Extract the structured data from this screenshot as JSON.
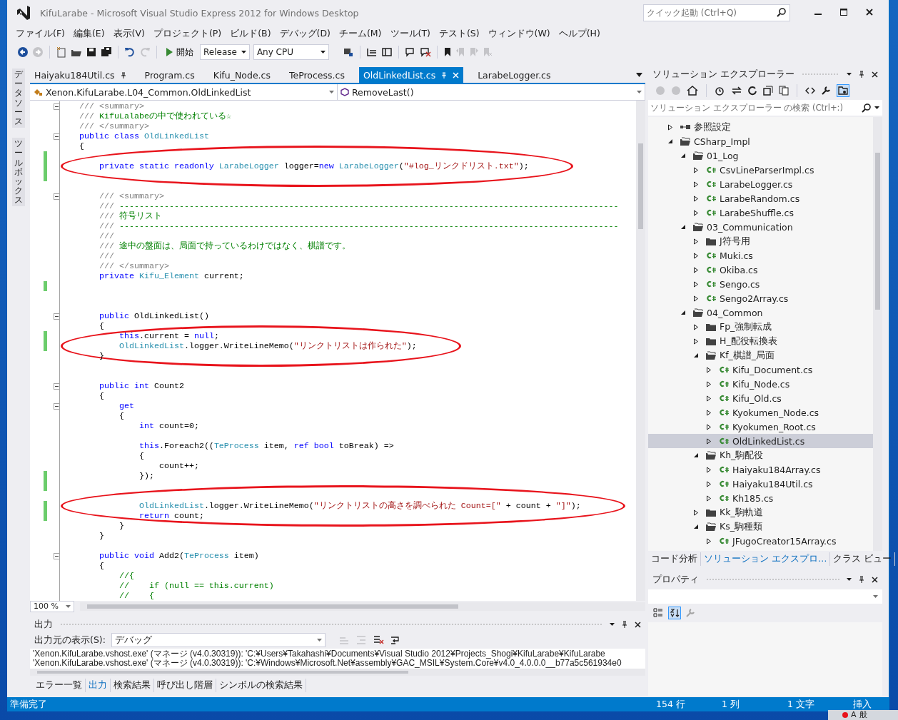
{
  "window": {
    "title": "KifuLarabe - Microsoft Visual Studio Express 2012 for Windows Desktop"
  },
  "quick_launch": {
    "placeholder": "クイック起動 (Ctrl+Q)"
  },
  "menu": [
    "ファイル(F)",
    "編集(E)",
    "表示(V)",
    "プロジェクト(P)",
    "ビルド(B)",
    "デバッグ(D)",
    "チーム(M)",
    "ツール(T)",
    "テスト(S)",
    "ウィンドウ(W)",
    "ヘルプ(H)"
  ],
  "toolbar": {
    "start_button": "開始",
    "configuration": "Release",
    "platform": "Any CPU"
  },
  "side_tabs": [
    "データソース",
    "ツールボックス"
  ],
  "editor": {
    "tabs": [
      {
        "label": "Haiyaku184Util.cs",
        "pinned": true,
        "selected": false
      },
      {
        "label": "Program.cs",
        "pinned": false,
        "selected": false
      },
      {
        "label": "Kifu_Node.cs",
        "pinned": false,
        "selected": false
      },
      {
        "label": "TeProcess.cs",
        "pinned": false,
        "selected": false
      },
      {
        "label": "OldLinkedList.cs",
        "pinned": true,
        "selected": true
      },
      {
        "label": "LarabeLogger.cs",
        "pinned": false,
        "selected": false
      }
    ],
    "type_selector": "Xenon.KifuLarabe.L04_Common.OldLinkedList",
    "member_selector": "RemoveLast()",
    "zoom": "100 %",
    "lines": [
      {
        "changed": false,
        "fold": true,
        "circled": false,
        "tokens": [
          {
            "kind": "doc",
            "text": "/// <summary>"
          }
        ]
      },
      {
        "changed": false,
        "fold": false,
        "circled": false,
        "tokens": [
          {
            "kind": "doc",
            "text": "/// "
          },
          {
            "kind": "comment",
            "text": "KifuLalabeの中で使われている☆"
          }
        ]
      },
      {
        "changed": false,
        "fold": false,
        "circled": false,
        "tokens": [
          {
            "kind": "doc",
            "text": "/// </summary>"
          }
        ]
      },
      {
        "changed": false,
        "fold": true,
        "circled": false,
        "tokens": [
          {
            "kind": "keyword",
            "text": "public class "
          },
          {
            "kind": "type",
            "text": "OldLinkedList"
          }
        ]
      },
      {
        "changed": false,
        "fold": false,
        "circled": false,
        "tokens": [
          {
            "kind": "plain",
            "text": "{"
          }
        ]
      },
      {
        "changed": true,
        "fold": false,
        "circled": false
      },
      {
        "changed": true,
        "fold": false,
        "circled": true,
        "tokens": [
          {
            "kind": "keyword",
            "text": "    private static readonly "
          },
          {
            "kind": "type",
            "text": "LarabeLogger"
          },
          {
            "kind": "plain",
            "text": " logger="
          },
          {
            "kind": "keyword",
            "text": "new "
          },
          {
            "kind": "type",
            "text": "LarabeLogger"
          },
          {
            "kind": "plain",
            "text": "("
          },
          {
            "kind": "string",
            "text": "\"#log_リンクドリスト.txt\""
          },
          {
            "kind": "plain",
            "text": ");"
          }
        ]
      },
      {
        "changed": true,
        "fold": false,
        "circled": false
      },
      {
        "changed": false,
        "fold": false,
        "circled": false
      },
      {
        "changed": false,
        "fold": true,
        "circled": false,
        "tokens": [
          {
            "kind": "doc",
            "text": "    /// <summary>"
          }
        ]
      },
      {
        "changed": false,
        "fold": false,
        "circled": false,
        "tokens": [
          {
            "kind": "doc",
            "text": "    /// "
          },
          {
            "kind": "comment",
            "text": "----------------------------------------------------------------------------------------------------"
          }
        ]
      },
      {
        "changed": false,
        "fold": false,
        "circled": false,
        "tokens": [
          {
            "kind": "doc",
            "text": "    /// "
          },
          {
            "kind": "comment",
            "text": "符号リスト"
          }
        ]
      },
      {
        "changed": false,
        "fold": false,
        "circled": false,
        "tokens": [
          {
            "kind": "doc",
            "text": "    /// "
          },
          {
            "kind": "comment",
            "text": "----------------------------------------------------------------------------------------------------"
          }
        ]
      },
      {
        "changed": false,
        "fold": false,
        "circled": false,
        "tokens": [
          {
            "kind": "doc",
            "text": "    ///"
          }
        ]
      },
      {
        "changed": false,
        "fold": false,
        "circled": false,
        "tokens": [
          {
            "kind": "doc",
            "text": "    /// "
          },
          {
            "kind": "comment",
            "text": "途中の盤面は、局面で持っているわけではなく、棋譜です。"
          }
        ]
      },
      {
        "changed": false,
        "fold": false,
        "circled": false,
        "tokens": [
          {
            "kind": "doc",
            "text": "    ///"
          }
        ]
      },
      {
        "changed": false,
        "fold": false,
        "circled": false,
        "tokens": [
          {
            "kind": "doc",
            "text": "    /// </summary>"
          }
        ]
      },
      {
        "changed": false,
        "fold": false,
        "circled": false,
        "tokens": [
          {
            "kind": "keyword",
            "text": "    private "
          },
          {
            "kind": "type",
            "text": "Kifu_Element"
          },
          {
            "kind": "plain",
            "text": " current;"
          }
        ]
      },
      {
        "changed": true,
        "fold": false,
        "circled": false
      },
      {
        "changed": false,
        "fold": false,
        "circled": false
      },
      {
        "changed": false,
        "fold": false,
        "circled": false
      },
      {
        "changed": false,
        "fold": true,
        "circled": false,
        "tokens": [
          {
            "kind": "keyword",
            "text": "    public "
          },
          {
            "kind": "plain",
            "text": "OldLinkedList()"
          }
        ]
      },
      {
        "changed": false,
        "fold": false,
        "circled": false,
        "tokens": [
          {
            "kind": "plain",
            "text": "    {"
          }
        ]
      },
      {
        "changed": true,
        "fold": false,
        "circled": false,
        "tokens": [
          {
            "kind": "keyword",
            "text": "        this"
          },
          {
            "kind": "plain",
            "text": ".current = "
          },
          {
            "kind": "keyword",
            "text": "null"
          },
          {
            "kind": "plain",
            "text": ";"
          }
        ]
      },
      {
        "changed": true,
        "fold": false,
        "circled": true,
        "tokens": [
          {
            "kind": "type",
            "text": "        OldLinkedList"
          },
          {
            "kind": "plain",
            "text": ".logger.WriteLineMemo("
          },
          {
            "kind": "string",
            "text": "\"リンクトリストは作られた\""
          },
          {
            "kind": "plain",
            "text": ");"
          }
        ]
      },
      {
        "changed": false,
        "fold": false,
        "circled": false,
        "tokens": [
          {
            "kind": "plain",
            "text": "    }"
          }
        ]
      },
      {
        "changed": false,
        "fold": false,
        "circled": false
      },
      {
        "changed": false,
        "fold": false,
        "circled": false
      },
      {
        "changed": false,
        "fold": true,
        "circled": false,
        "tokens": [
          {
            "kind": "keyword",
            "text": "    public int "
          },
          {
            "kind": "plain",
            "text": "Count2"
          }
        ]
      },
      {
        "changed": false,
        "fold": false,
        "circled": false,
        "tokens": [
          {
            "kind": "plain",
            "text": "    {"
          }
        ]
      },
      {
        "changed": false,
        "fold": true,
        "circled": false,
        "tokens": [
          {
            "kind": "keyword",
            "text": "        get"
          }
        ]
      },
      {
        "changed": false,
        "fold": false,
        "circled": false,
        "tokens": [
          {
            "kind": "plain",
            "text": "        {"
          }
        ]
      },
      {
        "changed": false,
        "fold": false,
        "circled": false,
        "tokens": [
          {
            "kind": "keyword",
            "text": "            int "
          },
          {
            "kind": "plain",
            "text": "count=0;"
          }
        ]
      },
      {
        "changed": false,
        "fold": false,
        "circled": false
      },
      {
        "changed": false,
        "fold": false,
        "circled": false,
        "tokens": [
          {
            "kind": "keyword",
            "text": "            this"
          },
          {
            "kind": "plain",
            "text": ".Foreach2(("
          },
          {
            "kind": "type",
            "text": "TeProcess"
          },
          {
            "kind": "plain",
            "text": " item, "
          },
          {
            "kind": "keyword",
            "text": "ref bool "
          },
          {
            "kind": "plain",
            "text": "toBreak) =>"
          }
        ]
      },
      {
        "changed": false,
        "fold": false,
        "circled": false,
        "tokens": [
          {
            "kind": "plain",
            "text": "            {"
          }
        ]
      },
      {
        "changed": false,
        "fold": false,
        "circled": false,
        "tokens": [
          {
            "kind": "plain",
            "text": "                count++;"
          }
        ]
      },
      {
        "changed": true,
        "fold": false,
        "circled": false,
        "tokens": [
          {
            "kind": "plain",
            "text": "            });"
          }
        ]
      },
      {
        "changed": true,
        "fold": false,
        "circled": false
      },
      {
        "changed": false,
        "fold": false,
        "circled": false
      },
      {
        "changed": true,
        "fold": false,
        "circled": true,
        "tokens": [
          {
            "kind": "type",
            "text": "            OldLinkedList"
          },
          {
            "kind": "plain",
            "text": ".logger.WriteLineMemo("
          },
          {
            "kind": "string",
            "text": "\"リンクトリストの高さを調べられた Count=[\""
          },
          {
            "kind": "plain",
            "text": " + count + "
          },
          {
            "kind": "string",
            "text": "\"]\""
          },
          {
            "kind": "plain",
            "text": ");"
          }
        ]
      },
      {
        "changed": true,
        "fold": false,
        "circled": false,
        "tokens": [
          {
            "kind": "keyword",
            "text": "            return "
          },
          {
            "kind": "plain",
            "text": "count;"
          }
        ]
      },
      {
        "changed": false,
        "fold": false,
        "circled": false,
        "tokens": [
          {
            "kind": "plain",
            "text": "        }"
          }
        ]
      },
      {
        "changed": false,
        "fold": false,
        "circled": false,
        "tokens": [
          {
            "kind": "plain",
            "text": "    }"
          }
        ]
      },
      {
        "changed": false,
        "fold": false,
        "circled": false
      },
      {
        "changed": false,
        "fold": true,
        "circled": false,
        "tokens": [
          {
            "kind": "keyword",
            "text": "    public void "
          },
          {
            "kind": "plain",
            "text": "Add2("
          },
          {
            "kind": "type",
            "text": "TeProcess"
          },
          {
            "kind": "plain",
            "text": " item)"
          }
        ]
      },
      {
        "changed": false,
        "fold": false,
        "circled": false,
        "tokens": [
          {
            "kind": "plain",
            "text": "    {"
          }
        ]
      },
      {
        "changed": false,
        "fold": false,
        "circled": false,
        "tokens": [
          {
            "kind": "comment",
            "text": "        //{"
          }
        ]
      },
      {
        "changed": false,
        "fold": false,
        "circled": false,
        "tokens": [
          {
            "kind": "comment",
            "text": "        //    if (null == this.current)"
          }
        ]
      },
      {
        "changed": false,
        "fold": false,
        "circled": false,
        "tokens": [
          {
            "kind": "comment",
            "text": "        //    {"
          }
        ]
      }
    ]
  },
  "output": {
    "title": "出力",
    "source_label": "出力元の表示(S):",
    "source": "デバッグ",
    "lines": [
      "'Xenon.KifuLarabe.vshost.exe' (マネージ (v4.0.30319)): 'C:¥Users¥Takahashi¥Documents¥Visual Studio 2012¥Projects_Shogi¥KifuLarabe¥KifuLarabe",
      "'Xenon.KifuLarabe.vshost.exe' (マネージ (v4.0.30319)): 'C:¥Windows¥Microsoft.Net¥assembly¥GAC_MSIL¥System.Core¥v4.0_4.0.0.0__b77a5c561934e0"
    ]
  },
  "bottom_tabs": [
    {
      "label": "エラー一覧",
      "selected": false
    },
    {
      "label": "出力",
      "selected": true
    },
    {
      "label": "検索結果",
      "selected": false
    },
    {
      "label": "呼び出し階層",
      "selected": false
    },
    {
      "label": "シンボルの検索結果",
      "selected": false
    }
  ],
  "solution_explorer": {
    "title": "ソリューション エクスプローラー",
    "search": {
      "placeholder": "ソリューション エクスプローラー の検索 (Ctrl+:)"
    },
    "tree": [
      {
        "label": "参照設定",
        "kind": "references",
        "expanded": false,
        "selected": false
      },
      {
        "label": "CSharp_Impl",
        "kind": "folder",
        "expanded": true,
        "selected": false,
        "children": [
          {
            "label": "01_Log",
            "kind": "folder",
            "expanded": true,
            "selected": false,
            "children": [
              {
                "label": "CsvLineParserImpl.cs",
                "kind": "csharp",
                "expanded": false,
                "selected": false
              },
              {
                "label": "LarabeLogger.cs",
                "kind": "csharp",
                "expanded": false,
                "selected": false
              },
              {
                "label": "LarabeRandom.cs",
                "kind": "csharp",
                "expanded": false,
                "selected": false
              },
              {
                "label": "LarabeShuffle.cs",
                "kind": "csharp",
                "expanded": false,
                "selected": false
              }
            ]
          },
          {
            "label": "03_Communication",
            "kind": "folder",
            "expanded": true,
            "selected": false,
            "children": [
              {
                "label": "J符号用",
                "kind": "folder",
                "expanded": false,
                "selected": false
              },
              {
                "label": "Muki.cs",
                "kind": "csharp",
                "expanded": false,
                "selected": false
              },
              {
                "label": "Okiba.cs",
                "kind": "csharp",
                "expanded": false,
                "selected": false
              },
              {
                "label": "Sengo.cs",
                "kind": "csharp",
                "expanded": false,
                "selected": false
              },
              {
                "label": "Sengo2Array.cs",
                "kind": "csharp",
                "expanded": false,
                "selected": false
              }
            ]
          },
          {
            "label": "04_Common",
            "kind": "folder",
            "expanded": true,
            "selected": false,
            "children": [
              {
                "label": "Fp_強制転成",
                "kind": "folder",
                "expanded": false,
                "selected": false
              },
              {
                "label": "H_配役転換表",
                "kind": "folder",
                "expanded": false,
                "selected": false
              },
              {
                "label": "Kf_棋譜_局面",
                "kind": "folder",
                "expanded": true,
                "selected": false,
                "children": [
                  {
                    "label": "Kifu_Document.cs",
                    "kind": "csharp",
                    "expanded": false,
                    "selected": false
                  },
                  {
                    "label": "Kifu_Node.cs",
                    "kind": "csharp",
                    "expanded": false,
                    "selected": false
                  },
                  {
                    "label": "Kifu_Old.cs",
                    "kind": "csharp",
                    "expanded": false,
                    "selected": false
                  },
                  {
                    "label": "Kyokumen_Node.cs",
                    "kind": "csharp",
                    "expanded": false,
                    "selected": false
                  },
                  {
                    "label": "Kyokumen_Root.cs",
                    "kind": "csharp",
                    "expanded": false,
                    "selected": false
                  },
                  {
                    "label": "OldLinkedList.cs",
                    "kind": "csharp",
                    "expanded": false,
                    "selected": true
                  }
                ]
              },
              {
                "label": "Kh_駒配役",
                "kind": "folder",
                "expanded": true,
                "selected": false,
                "children": [
                  {
                    "label": "Haiyaku184Array.cs",
                    "kind": "csharp",
                    "expanded": false,
                    "selected": false
                  },
                  {
                    "label": "Haiyaku184Util.cs",
                    "kind": "csharp",
                    "expanded": false,
                    "selected": false
                  },
                  {
                    "label": "Kh185.cs",
                    "kind": "csharp",
                    "expanded": false,
                    "selected": false
                  }
                ]
              },
              {
                "label": "Kk_駒軌道",
                "kind": "folder",
                "expanded": false,
                "selected": false
              },
              {
                "label": "Ks_駒種類",
                "kind": "folder",
                "expanded": true,
                "selected": false,
                "children": [
                  {
                    "label": "JFugoCreator15Array.cs",
                    "kind": "csharp",
                    "expanded": false,
                    "selected": false
                  }
                ]
              }
            ]
          }
        ]
      }
    ],
    "tabs": [
      {
        "label": "コード分析",
        "selected": false
      },
      {
        "label": "ソリューション エクスプロ…",
        "selected": true
      },
      {
        "label": "クラス ビュー",
        "selected": false
      }
    ]
  },
  "properties": {
    "title": "プロパティ"
  },
  "status_bar": {
    "message": "準備完了",
    "line": "154 行",
    "column": "1 列",
    "character": "1 文字",
    "mode": "挿入"
  },
  "taskbar": {
    "ime_mode": "A",
    "ime_state": "般"
  }
}
